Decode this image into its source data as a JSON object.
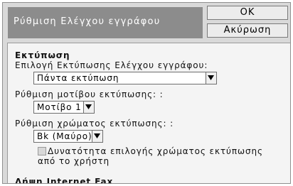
{
  "dialog": {
    "title": "Ρύθμιση Ελέγχου εγγράφου",
    "ok_label": "OK",
    "cancel_label": "Ακύρωση"
  },
  "print_section": {
    "heading": "Εκτύπωση",
    "print_select_label": "Επιλογή Εκτύπωσης Ελέγχου εγγράφου:",
    "print_select_value": "Πάντα εκτύπωση",
    "pattern_label": "Ρύθμιση μοτίβου εκτύπωσης: :",
    "pattern_value": "Μοτίβο 1",
    "color_label": "Ρύθμιση χρώματος εκτύπωσης: :",
    "color_value": "Bk (Μαύρο)",
    "user_color_checkbox_line1": "Δυνατότητα επιλογής χρώματος εκτύπωσης",
    "user_color_checkbox_line2": "από το χρήστη",
    "user_color_checked": false
  },
  "next_section": {
    "heading": "Λήψη Internet Fax"
  },
  "icons": {
    "dropdown_arrow": "triangle-down-icon",
    "checkbox": "checkbox-icon"
  },
  "colors": {
    "title_bg": "#8c8c8c",
    "title_text": "#ffffff",
    "chrome_bg": "#d9d9d9",
    "panel_bg": "#f4f4f4",
    "button_bg": "#ececec"
  }
}
